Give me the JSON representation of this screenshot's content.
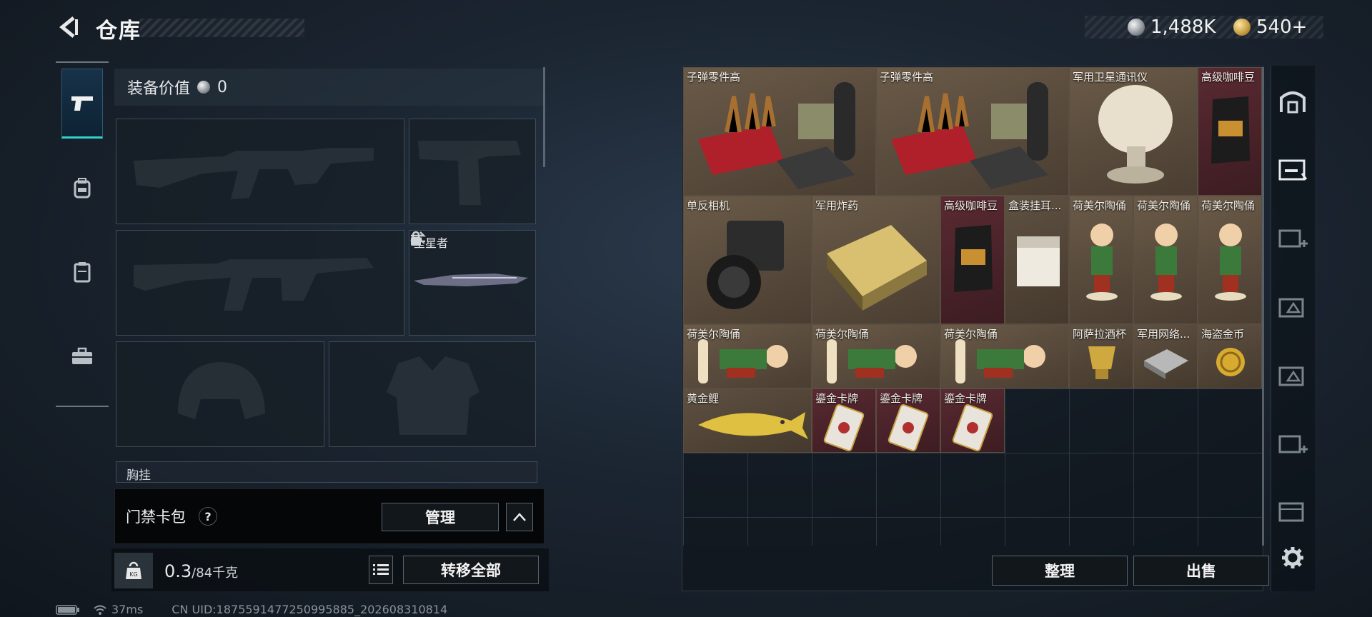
{
  "header": {
    "title": "仓库"
  },
  "currency": {
    "silver": "1,488K",
    "gold": "540+"
  },
  "equipment": {
    "value_label": "装备价值",
    "value": "0",
    "melee_name": "坠星者",
    "chest_label": "胸挂"
  },
  "access_card": {
    "label": "门禁卡包",
    "help": "?",
    "manage": "管理"
  },
  "weight": {
    "current": "0.3",
    "max": "/84千克",
    "transfer_all": "转移全部",
    "kg": "KG"
  },
  "status": {
    "ping": "37ms",
    "uid": "CN UID:1875591477250995885_202608310814"
  },
  "inventory": {
    "items": [
      {
        "label": "子弹零件高"
      },
      {
        "label": "子弹零件高"
      },
      {
        "label": "军用卫星通讯仪"
      },
      {
        "label": "高级咖啡豆"
      },
      {
        "label": "单反相机"
      },
      {
        "label": "军用炸药"
      },
      {
        "label": "高级咖啡豆"
      },
      {
        "label": "盒装挂耳..."
      },
      {
        "label": "荷美尔陶俑"
      },
      {
        "label": "荷美尔陶俑"
      },
      {
        "label": "荷美尔陶俑"
      },
      {
        "label": "荷美尔陶俑"
      },
      {
        "label": "荷美尔陶俑"
      },
      {
        "label": "荷美尔陶俑"
      },
      {
        "label": "阿萨拉酒杯"
      },
      {
        "label": "军用网络..."
      },
      {
        "label": "海盗金币"
      },
      {
        "label": "黄金鲤"
      },
      {
        "label": "鎏金卡牌"
      },
      {
        "label": "鎏金卡牌"
      },
      {
        "label": "鎏金卡牌"
      }
    ],
    "sort": "整理",
    "sell": "出售"
  },
  "colors": {
    "accent": "#2fd3c8",
    "item_brown": "#5e5142",
    "item_red": "#4a2228"
  }
}
